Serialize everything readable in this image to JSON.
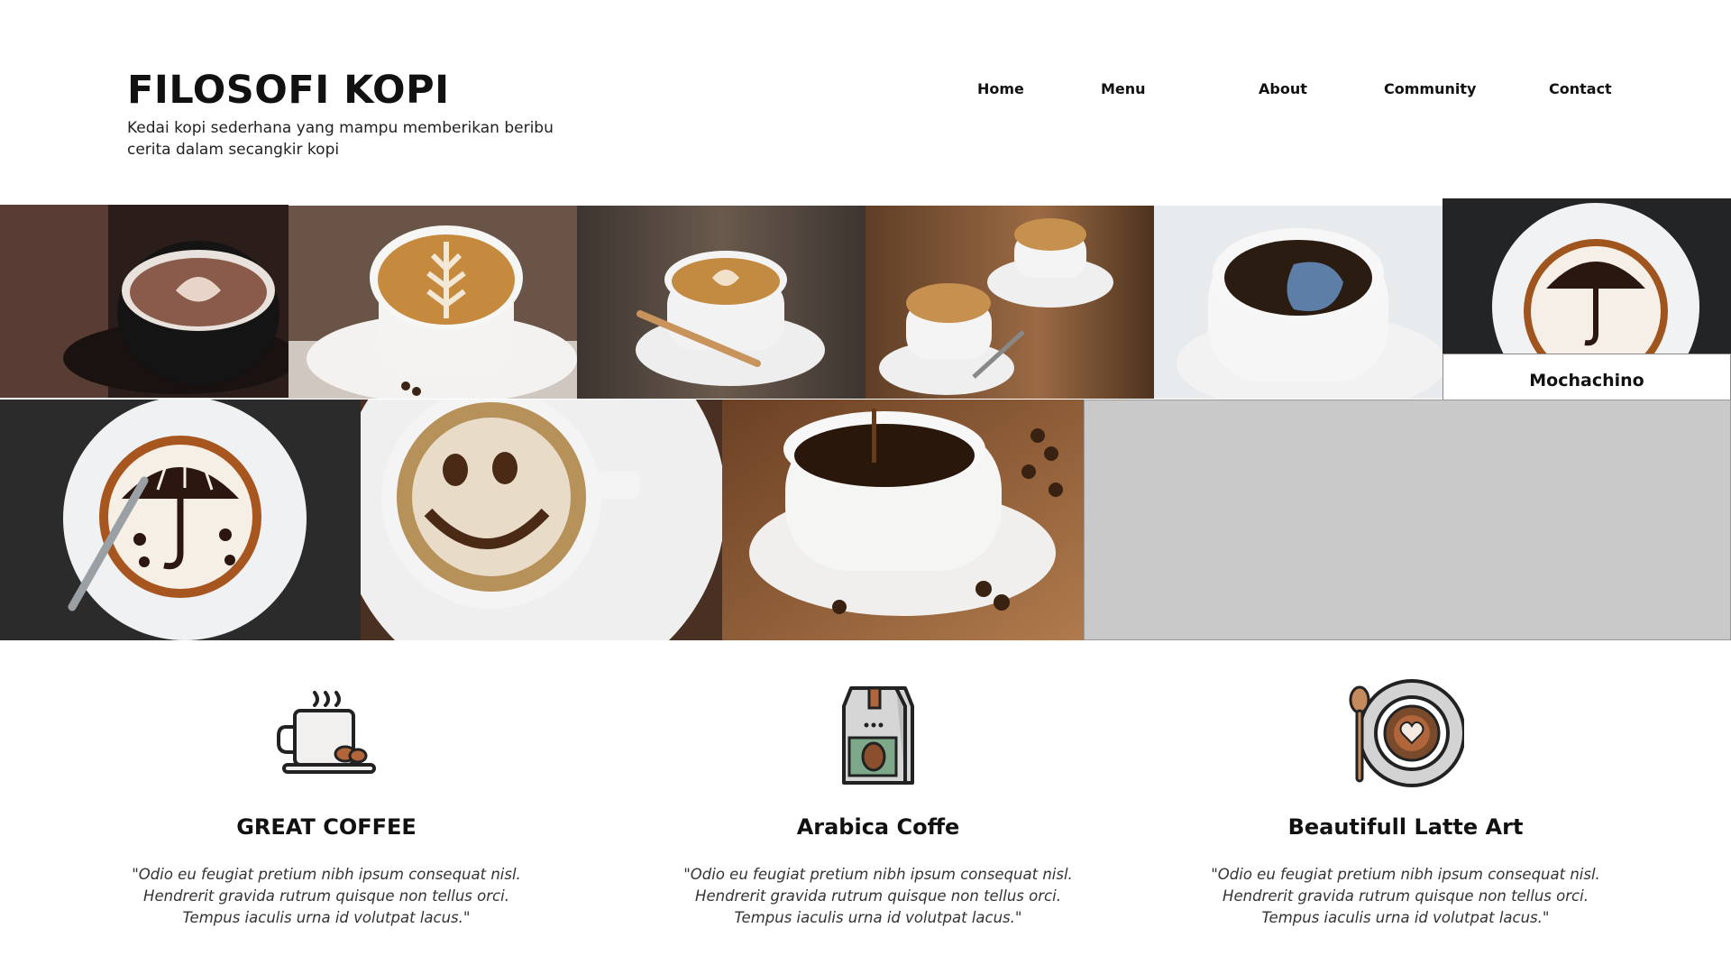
{
  "header": {
    "title": "FILOSOFI KOPI",
    "tagline": "Kedai kopi sederhana yang mampu memberikan beribu cerita dalam secangkir kopi"
  },
  "nav": {
    "items": [
      "Home",
      "Menu",
      "About",
      "Community",
      "Contact"
    ]
  },
  "gallery": {
    "hovered_caption": "Mochachino"
  },
  "features": [
    {
      "icon": "coffee-cup-icon",
      "title": "GREAT COFFEE",
      "text": "\"Odio eu feugiat pretium nibh ipsum consequat nisl. Hendrerit gravida rutrum quisque non tellus orci. Tempus iaculis urna id volutpat lacus.\""
    },
    {
      "icon": "coffee-bag-icon",
      "title": "Arabica Coffe",
      "text": "\"Odio eu feugiat pretium nibh ipsum consequat nisl. Hendrerit gravida rutrum quisque non tellus orci. Tempus iaculis urna id volutpat lacus.\""
    },
    {
      "icon": "latte-art-icon",
      "title": "Beautifull Latte Art",
      "text": "\"Odio eu feugiat pretium nibh ipsum consequat nisl. Hendrerit gravida rutrum quisque non tellus orci. Tempus iaculis urna id volutpat lacus.\""
    }
  ],
  "colors": {
    "text": "#111111",
    "panel_grey": "#c9c9c9",
    "coffee_dark": "#4a2a14",
    "crema": "#c88a45"
  }
}
